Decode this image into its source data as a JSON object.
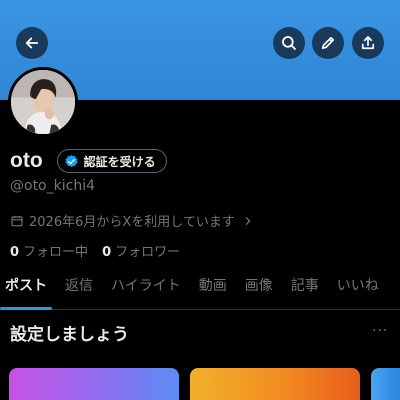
{
  "profile": {
    "name": "oto",
    "verify_label": "認証を受ける",
    "handle": "@oto_kichi4",
    "joined": "2026年6月からXを利用しています",
    "following_count": "0",
    "following_label": "フォロー中",
    "followers_count": "0",
    "followers_label": "フォロワー"
  },
  "tabs": [
    {
      "label": "ポスト",
      "active": true
    },
    {
      "label": "返信"
    },
    {
      "label": "ハイライト"
    },
    {
      "label": "動画"
    },
    {
      "label": "画像"
    },
    {
      "label": "記事"
    },
    {
      "label": "いいね"
    }
  ],
  "setup": {
    "title": "設定しましょう",
    "more": "···"
  },
  "colors": {
    "banner": "#3a95e3",
    "accent": "#1d9bf0",
    "background": "#000000",
    "text": "#e7e9ea",
    "muted": "#71767b"
  },
  "icons": {
    "back": "arrow-left-icon",
    "search": "search-icon",
    "edit": "pencil-icon",
    "share": "share-icon",
    "verified": "verified-badge-icon",
    "calendar": "calendar-icon",
    "chevron": "chevron-right-icon"
  }
}
